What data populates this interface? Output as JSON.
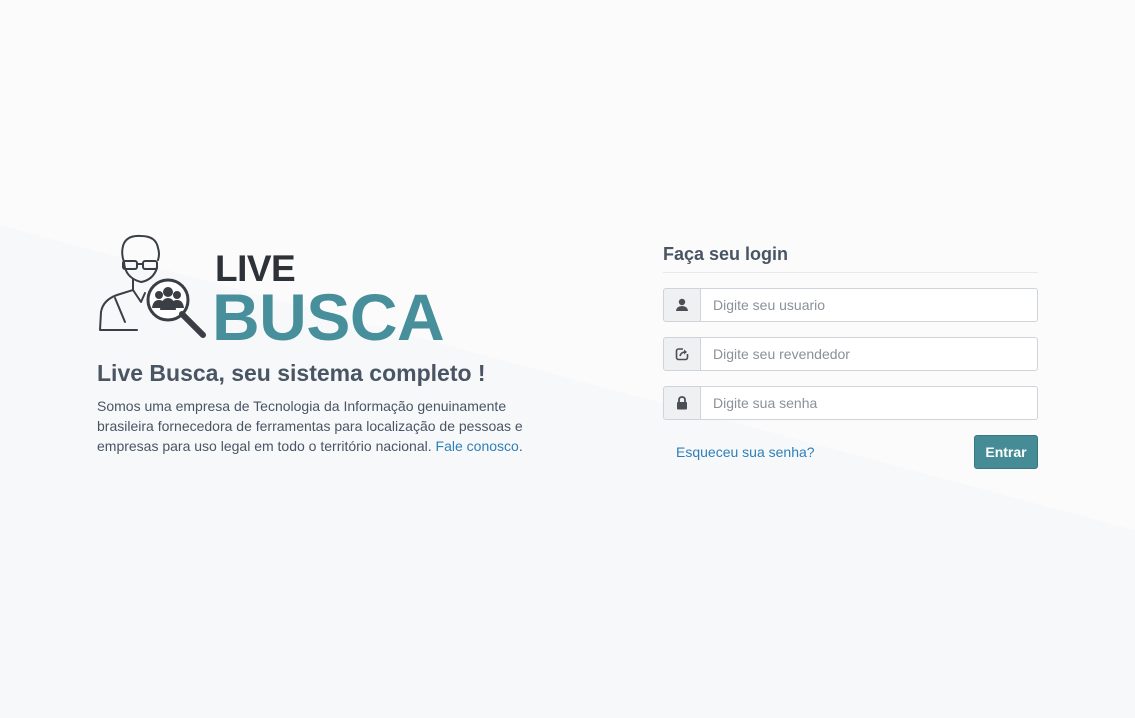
{
  "brand": {
    "logo_top": "LIVE",
    "logo_bottom": "BUSCA",
    "tagline": "Live Busca, seu sistema completo !",
    "description": "Somos uma empresa de Tecnologia da Informação genuinamente brasileira fornecedora de ferramentas para localização de pessoas e empresas para uso legal em todo o território nacional.",
    "contact_link": "Fale conosco",
    "description_end": "."
  },
  "login": {
    "title": "Faça seu login",
    "username": {
      "placeholder": "Digite seu usuario",
      "value": "",
      "icon": "user-icon"
    },
    "reseller": {
      "placeholder": "Digite seu revendedor",
      "value": "",
      "icon": "share-icon"
    },
    "password": {
      "placeholder": "Digite sua senha",
      "value": "",
      "icon": "lock-icon"
    },
    "forgot_label": "Esqueceu sua senha?",
    "submit_label": "Entrar"
  },
  "colors": {
    "brand_teal": "#478f9a",
    "brand_dark": "#2d3138",
    "text": "#4a5564",
    "link": "#2f7fb8",
    "button": "#458c97"
  }
}
